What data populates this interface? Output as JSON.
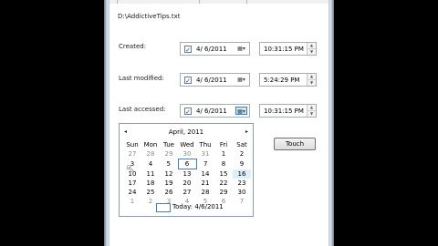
{
  "file_path": "D:\\AddictiveTips.txt",
  "rows": [
    {
      "label": "Created:",
      "date": "4/  6/2011",
      "time": "10:31:15 PM"
    },
    {
      "label": "Last modified:",
      "date": "4/  6/2011",
      "time": "5:24:29 PM"
    },
    {
      "label": "Last accessed:",
      "date": "4/  6/2011",
      "time": "10:31:15 PM"
    }
  ],
  "touch_label": "Touch",
  "icons": {
    "checkbox": "checkmark-icon",
    "calendar": "calendar-dropdown-icon",
    "spin_up": "arrow-up-icon",
    "spin_down": "arrow-down-icon"
  },
  "calendar": {
    "month_title": "April, 2011",
    "prev": "◂",
    "next": "▸",
    "weekdays": [
      "Sun",
      "Mon",
      "Tue",
      "Wed",
      "Thu",
      "Fri",
      "Sat"
    ],
    "weeks": [
      [
        "27",
        "28",
        "29",
        "30",
        "31",
        "1",
        "2"
      ],
      [
        "3",
        "4",
        "5",
        "6",
        "7",
        "8",
        "9"
      ],
      [
        "10",
        "11",
        "12",
        "13",
        "14",
        "15",
        "16"
      ],
      [
        "17",
        "18",
        "19",
        "20",
        "21",
        "22",
        "23"
      ],
      [
        "24",
        "25",
        "26",
        "27",
        "28",
        "29",
        "30"
      ],
      [
        "1",
        "2",
        "3",
        "4",
        "5",
        "6",
        "7"
      ]
    ],
    "today_label": "Today: 4/6/2011"
  },
  "colors": {
    "accent": "#3c7fb1"
  }
}
